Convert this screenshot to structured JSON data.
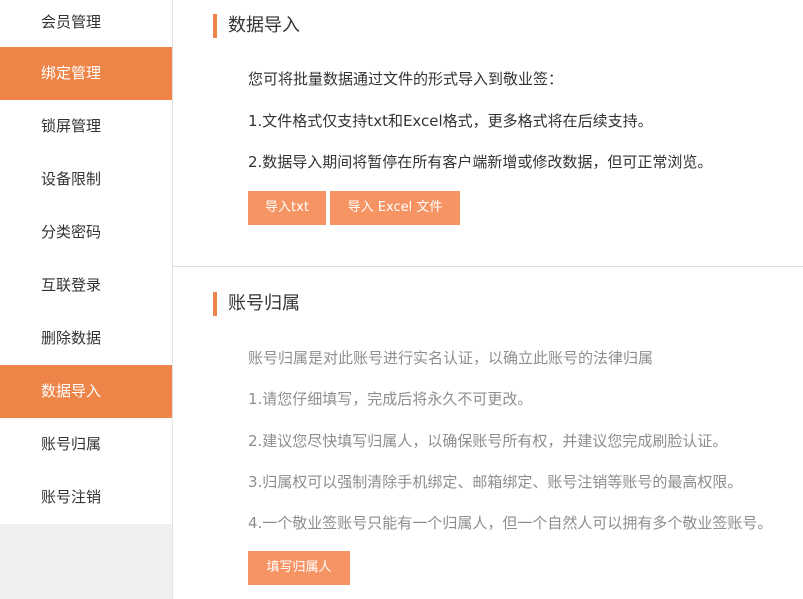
{
  "sidebar": {
    "items": [
      {
        "label": "会员管理",
        "active": false
      },
      {
        "label": "绑定管理",
        "active": true
      },
      {
        "label": "锁屏管理",
        "active": false
      },
      {
        "label": "设备限制",
        "active": false
      },
      {
        "label": "分类密码",
        "active": false
      },
      {
        "label": "互联登录",
        "active": false
      },
      {
        "label": "删除数据",
        "active": false
      },
      {
        "label": "数据导入",
        "active": true
      },
      {
        "label": "账号归属",
        "active": false
      },
      {
        "label": "账号注销",
        "active": false
      }
    ]
  },
  "import": {
    "title": "数据导入",
    "intro": "您可将批量数据通过文件的形式导入到敬业签：",
    "note1": "1.文件格式仅支持txt和Excel格式，更多格式将在后续支持。",
    "note2": "2.数据导入期间将暂停在所有客户端新增或修改数据，但可正常浏览。",
    "btn_txt": "导入txt",
    "btn_excel": "导入 Excel 文件"
  },
  "ownership": {
    "title": "账号归属",
    "intro": "账号归属是对此账号进行实名认证，以确立此账号的法律归属",
    "note1": "1.请您仔细填写，完成后将永久不可更改。",
    "note2": "2.建议您尽快填写归属人，以确保账号所有权，并建议您完成刷脸认证。",
    "note3": "3.归属权可以强制清除手机绑定、邮箱绑定、账号注销等账号的最高权限。",
    "note4": "4.一个敬业签账号只能有一个归属人，但一个自然人可以拥有多个敬业签账号。",
    "btn_fill": "填写归属人"
  },
  "colors": {
    "accent": "#ee8448",
    "button": "#f69464",
    "sidebar_bg": "#efefef"
  }
}
